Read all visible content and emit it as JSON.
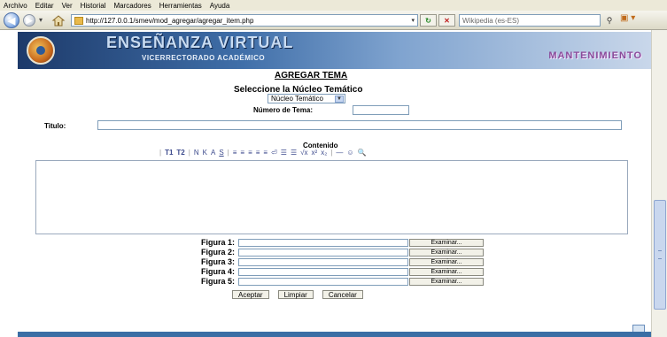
{
  "menubar": {
    "items": [
      "Archivo",
      "Editar",
      "Ver",
      "Historial",
      "Marcadores",
      "Herramientas",
      "Ayuda"
    ]
  },
  "browser": {
    "url": "http://127.0.0.1/smev/mod_agregar/agregar_item.php",
    "search_placeholder": "Wikipedia (es-ES)"
  },
  "banner": {
    "title": "ENSEÑANZA VIRTUAL",
    "subtitle": "VICERRECTORADO ACADÉMICO",
    "maintenance": "MANTENIMIENTO"
  },
  "form": {
    "heading": "AGREGAR TEMA",
    "select_label": "Seleccione la Núcleo Temático",
    "select_value": "Núcleo Temático",
    "number_label": "Número de Tema:",
    "title_label": "Titulo:",
    "content_label": "Contenido",
    "toolbar_items": [
      "T1",
      "T2",
      "N",
      "K",
      "A",
      "S",
      "≡",
      "≡",
      "≡",
      "≡",
      "≡",
      "⏎",
      "☰",
      "☰",
      "√x",
      "x²",
      "x₂",
      "—",
      "☺",
      "🔍"
    ],
    "figures": [
      {
        "label": "Figura 1:",
        "button": "Examinar..."
      },
      {
        "label": "Figura 2:",
        "button": "Examinar..."
      },
      {
        "label": "Figura 3:",
        "button": "Examinar..."
      },
      {
        "label": "Figura 4:",
        "button": "Examinar..."
      },
      {
        "label": "Figura 5:",
        "button": "Examinar..."
      }
    ],
    "actions": {
      "accept": "Aceptar",
      "clear": "Limpiar",
      "cancel": "Cancelar"
    }
  },
  "colors": {
    "banner_dark": "#1d3a6a",
    "footer_bar": "#3a6ea5",
    "maintenance_text": "#8a4a9a"
  }
}
